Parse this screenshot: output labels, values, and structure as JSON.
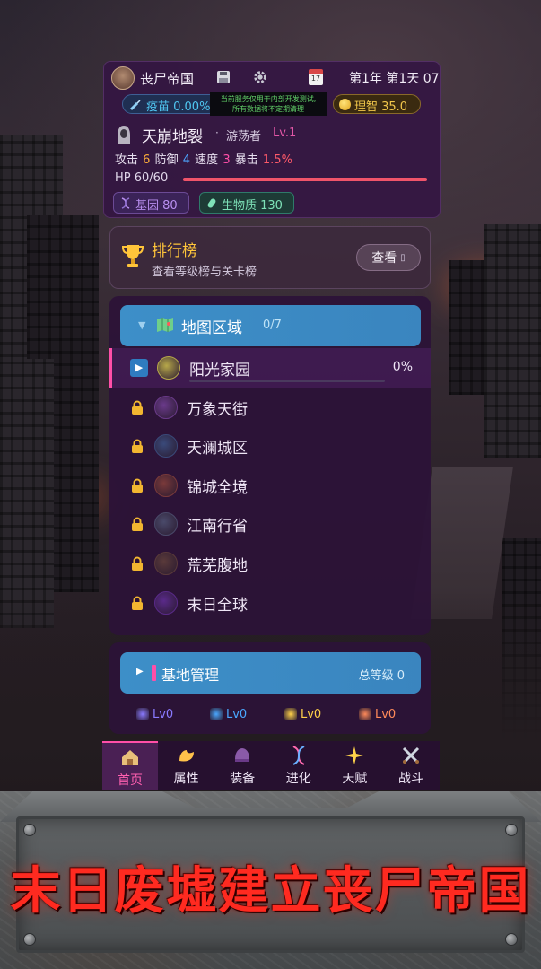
{
  "header": {
    "empire_name": "丧尸帝国",
    "date_text": "第1年 第1天 07:",
    "calendar_day": "17",
    "vaccine_label": "疫苗 0.00%",
    "notice_line1": "当前服务仅用于内部开发测试,",
    "notice_line2": "所有数据将不定期清理",
    "sanity_label": "理智 35.0"
  },
  "character": {
    "name": "天崩地裂",
    "dot": "·",
    "class": "游荡者",
    "level": "Lv.1",
    "stats": {
      "atk_label": "攻击",
      "atk": "6",
      "def_label": "防御",
      "def": "4",
      "spd_label": "速度",
      "spd": "3",
      "crit_label": "暴击",
      "crit": "1.5%"
    },
    "hp_text": "HP 60/60",
    "hp_fraction": 1.0,
    "gene_label": "基因 80",
    "bio_label": "生物质 130"
  },
  "ranking": {
    "title": "排行榜",
    "subtitle": "查看等级榜与关卡榜",
    "view_label": "查看",
    "view_arrow": "▯"
  },
  "map": {
    "caret": "▼",
    "title": "地图区域",
    "count": "0/7",
    "regions": [
      {
        "name": "阳光家园",
        "progress": "0%",
        "progress_fraction": 0,
        "locked": false,
        "thumb_color": "#b7a84a"
      },
      {
        "name": "万象天街",
        "locked": true,
        "thumb_color": "#6a3a8a"
      },
      {
        "name": "天澜城区",
        "locked": true,
        "thumb_color": "#3a4a7a"
      },
      {
        "name": "锦城全境",
        "locked": true,
        "thumb_color": "#7a3a3a"
      },
      {
        "name": "江南行省",
        "locked": true,
        "thumb_color": "#4a4a6a"
      },
      {
        "name": "荒芜腹地",
        "locked": true,
        "thumb_color": "#5a3a3a"
      },
      {
        "name": "末日全球",
        "locked": true,
        "thumb_color": "#5a2a8a"
      }
    ]
  },
  "base": {
    "play": "▶",
    "title": "基地管理",
    "total_level": "总等级 0",
    "facilities": [
      {
        "level": "Lv0",
        "color": "#8a7aff",
        "icon": "pen-icon"
      },
      {
        "level": "Lv0",
        "color": "#4aa8ff",
        "icon": "water-drop-icon"
      },
      {
        "level": "Lv0",
        "color": "#ffd04a",
        "icon": "recycle-icon"
      },
      {
        "level": "Lv0",
        "color": "#ff8a5a",
        "icon": "ore-icon"
      }
    ]
  },
  "nav": [
    {
      "label": "首页",
      "icon": "home-icon",
      "active": true
    },
    {
      "label": "属性",
      "icon": "muscle-icon",
      "active": false
    },
    {
      "label": "装备",
      "icon": "helmet-icon",
      "active": false
    },
    {
      "label": "进化",
      "icon": "dna-icon",
      "active": false
    },
    {
      "label": "天赋",
      "icon": "sparkle-icon",
      "active": false
    },
    {
      "label": "战斗",
      "icon": "crossed-swords-icon",
      "active": false
    }
  ],
  "banner": {
    "title": "末日废墟建立丧尸帝国"
  },
  "colors": {
    "accent_pink": "#ff4fa8",
    "header_blue": "#3d8fc8",
    "panel_purple": "#2c1238",
    "banner_red": "#ff2a20"
  }
}
